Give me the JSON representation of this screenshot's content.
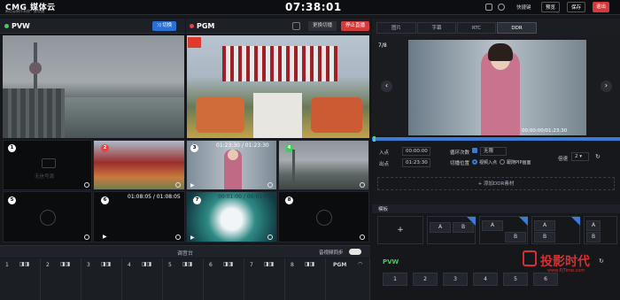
{
  "header": {
    "logo": "CMG 媒体云",
    "logo_sub": "新信云制作系统 · 云导播",
    "clock": "07:38:01",
    "shortcut_label": "快捷键",
    "preview_btn": "预览",
    "save_btn": "保存",
    "exit_btn": "退出"
  },
  "pvw": {
    "label": "PVW",
    "cut_btn": "切换"
  },
  "pgm": {
    "label": "PGM",
    "switch_btn": "更换切播",
    "stop_btn": "停止直播"
  },
  "right_tabs": [
    "图片",
    "字幕",
    "RTC",
    "DDR"
  ],
  "ddr": {
    "counter": "7/8",
    "timecode": "00:00:00/01:23:30",
    "in_label": "入点",
    "in_value": "00:00:00",
    "out_label": "出点",
    "out_value": "01:23:30",
    "loop_label": "循环次数",
    "loop_value": "无限",
    "play_pos_label": "切播位置",
    "opt1": "视频入点",
    "opt2": "跟随PIP画面",
    "speed_label": "倍速",
    "speed_value": "2",
    "add_btn": "+ 添加DDR素材"
  },
  "sources": [
    {
      "num": "1",
      "text": "无信号源",
      "timecode": ""
    },
    {
      "num": "2",
      "text": "",
      "timecode": ""
    },
    {
      "num": "3",
      "text": "",
      "timecode": "01:23:30 / 01:23:30"
    },
    {
      "num": "4",
      "text": "",
      "timecode": ""
    },
    {
      "num": "5",
      "text": "",
      "timecode": ""
    },
    {
      "num": "6",
      "text": "",
      "timecode": "01:08:05 / 01:08:05"
    },
    {
      "num": "7",
      "text": "",
      "timecode": "00:01:00 / 00:01:00"
    },
    {
      "num": "8",
      "text": "",
      "timecode": ""
    }
  ],
  "mixer": {
    "title": "调音台",
    "sync_label": "音视频同步",
    "channels": [
      "1",
      "2",
      "3",
      "4",
      "5",
      "6",
      "7",
      "8",
      "PGM"
    ]
  },
  "template": {
    "title": "模板",
    "add": "+"
  },
  "keys": [
    "A",
    "B",
    "A",
    "B",
    "A",
    "B",
    "A",
    "B"
  ],
  "pvw_bus": {
    "label": "PVW",
    "buttons": [
      "1",
      "2",
      "3",
      "4",
      "5",
      "6"
    ]
  },
  "watermark": {
    "text": "投影时代",
    "url": "www.PjTime.com"
  }
}
